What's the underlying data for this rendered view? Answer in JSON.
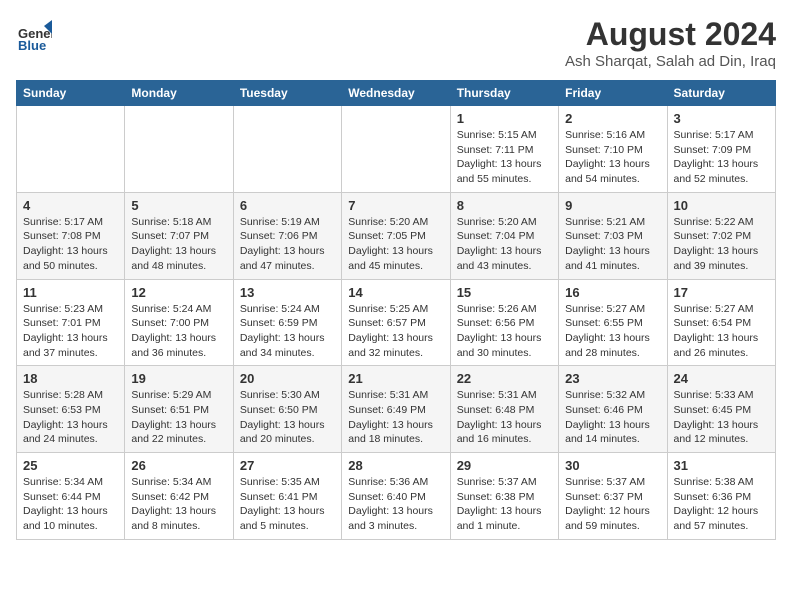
{
  "logo": {
    "line1": "General",
    "line2": "Blue"
  },
  "title": "August 2024",
  "subtitle": "Ash Sharqat, Salah ad Din, Iraq",
  "weekdays": [
    "Sunday",
    "Monday",
    "Tuesday",
    "Wednesday",
    "Thursday",
    "Friday",
    "Saturday"
  ],
  "weeks": [
    [
      {
        "day": "",
        "info": ""
      },
      {
        "day": "",
        "info": ""
      },
      {
        "day": "",
        "info": ""
      },
      {
        "day": "",
        "info": ""
      },
      {
        "day": "1",
        "info": "Sunrise: 5:15 AM\nSunset: 7:11 PM\nDaylight: 13 hours\nand 55 minutes."
      },
      {
        "day": "2",
        "info": "Sunrise: 5:16 AM\nSunset: 7:10 PM\nDaylight: 13 hours\nand 54 minutes."
      },
      {
        "day": "3",
        "info": "Sunrise: 5:17 AM\nSunset: 7:09 PM\nDaylight: 13 hours\nand 52 minutes."
      }
    ],
    [
      {
        "day": "4",
        "info": "Sunrise: 5:17 AM\nSunset: 7:08 PM\nDaylight: 13 hours\nand 50 minutes."
      },
      {
        "day": "5",
        "info": "Sunrise: 5:18 AM\nSunset: 7:07 PM\nDaylight: 13 hours\nand 48 minutes."
      },
      {
        "day": "6",
        "info": "Sunrise: 5:19 AM\nSunset: 7:06 PM\nDaylight: 13 hours\nand 47 minutes."
      },
      {
        "day": "7",
        "info": "Sunrise: 5:20 AM\nSunset: 7:05 PM\nDaylight: 13 hours\nand 45 minutes."
      },
      {
        "day": "8",
        "info": "Sunrise: 5:20 AM\nSunset: 7:04 PM\nDaylight: 13 hours\nand 43 minutes."
      },
      {
        "day": "9",
        "info": "Sunrise: 5:21 AM\nSunset: 7:03 PM\nDaylight: 13 hours\nand 41 minutes."
      },
      {
        "day": "10",
        "info": "Sunrise: 5:22 AM\nSunset: 7:02 PM\nDaylight: 13 hours\nand 39 minutes."
      }
    ],
    [
      {
        "day": "11",
        "info": "Sunrise: 5:23 AM\nSunset: 7:01 PM\nDaylight: 13 hours\nand 37 minutes."
      },
      {
        "day": "12",
        "info": "Sunrise: 5:24 AM\nSunset: 7:00 PM\nDaylight: 13 hours\nand 36 minutes."
      },
      {
        "day": "13",
        "info": "Sunrise: 5:24 AM\nSunset: 6:59 PM\nDaylight: 13 hours\nand 34 minutes."
      },
      {
        "day": "14",
        "info": "Sunrise: 5:25 AM\nSunset: 6:57 PM\nDaylight: 13 hours\nand 32 minutes."
      },
      {
        "day": "15",
        "info": "Sunrise: 5:26 AM\nSunset: 6:56 PM\nDaylight: 13 hours\nand 30 minutes."
      },
      {
        "day": "16",
        "info": "Sunrise: 5:27 AM\nSunset: 6:55 PM\nDaylight: 13 hours\nand 28 minutes."
      },
      {
        "day": "17",
        "info": "Sunrise: 5:27 AM\nSunset: 6:54 PM\nDaylight: 13 hours\nand 26 minutes."
      }
    ],
    [
      {
        "day": "18",
        "info": "Sunrise: 5:28 AM\nSunset: 6:53 PM\nDaylight: 13 hours\nand 24 minutes."
      },
      {
        "day": "19",
        "info": "Sunrise: 5:29 AM\nSunset: 6:51 PM\nDaylight: 13 hours\nand 22 minutes."
      },
      {
        "day": "20",
        "info": "Sunrise: 5:30 AM\nSunset: 6:50 PM\nDaylight: 13 hours\nand 20 minutes."
      },
      {
        "day": "21",
        "info": "Sunrise: 5:31 AM\nSunset: 6:49 PM\nDaylight: 13 hours\nand 18 minutes."
      },
      {
        "day": "22",
        "info": "Sunrise: 5:31 AM\nSunset: 6:48 PM\nDaylight: 13 hours\nand 16 minutes."
      },
      {
        "day": "23",
        "info": "Sunrise: 5:32 AM\nSunset: 6:46 PM\nDaylight: 13 hours\nand 14 minutes."
      },
      {
        "day": "24",
        "info": "Sunrise: 5:33 AM\nSunset: 6:45 PM\nDaylight: 13 hours\nand 12 minutes."
      }
    ],
    [
      {
        "day": "25",
        "info": "Sunrise: 5:34 AM\nSunset: 6:44 PM\nDaylight: 13 hours\nand 10 minutes."
      },
      {
        "day": "26",
        "info": "Sunrise: 5:34 AM\nSunset: 6:42 PM\nDaylight: 13 hours\nand 8 minutes."
      },
      {
        "day": "27",
        "info": "Sunrise: 5:35 AM\nSunset: 6:41 PM\nDaylight: 13 hours\nand 5 minutes."
      },
      {
        "day": "28",
        "info": "Sunrise: 5:36 AM\nSunset: 6:40 PM\nDaylight: 13 hours\nand 3 minutes."
      },
      {
        "day": "29",
        "info": "Sunrise: 5:37 AM\nSunset: 6:38 PM\nDaylight: 13 hours\nand 1 minute."
      },
      {
        "day": "30",
        "info": "Sunrise: 5:37 AM\nSunset: 6:37 PM\nDaylight: 12 hours\nand 59 minutes."
      },
      {
        "day": "31",
        "info": "Sunrise: 5:38 AM\nSunset: 6:36 PM\nDaylight: 12 hours\nand 57 minutes."
      }
    ]
  ]
}
